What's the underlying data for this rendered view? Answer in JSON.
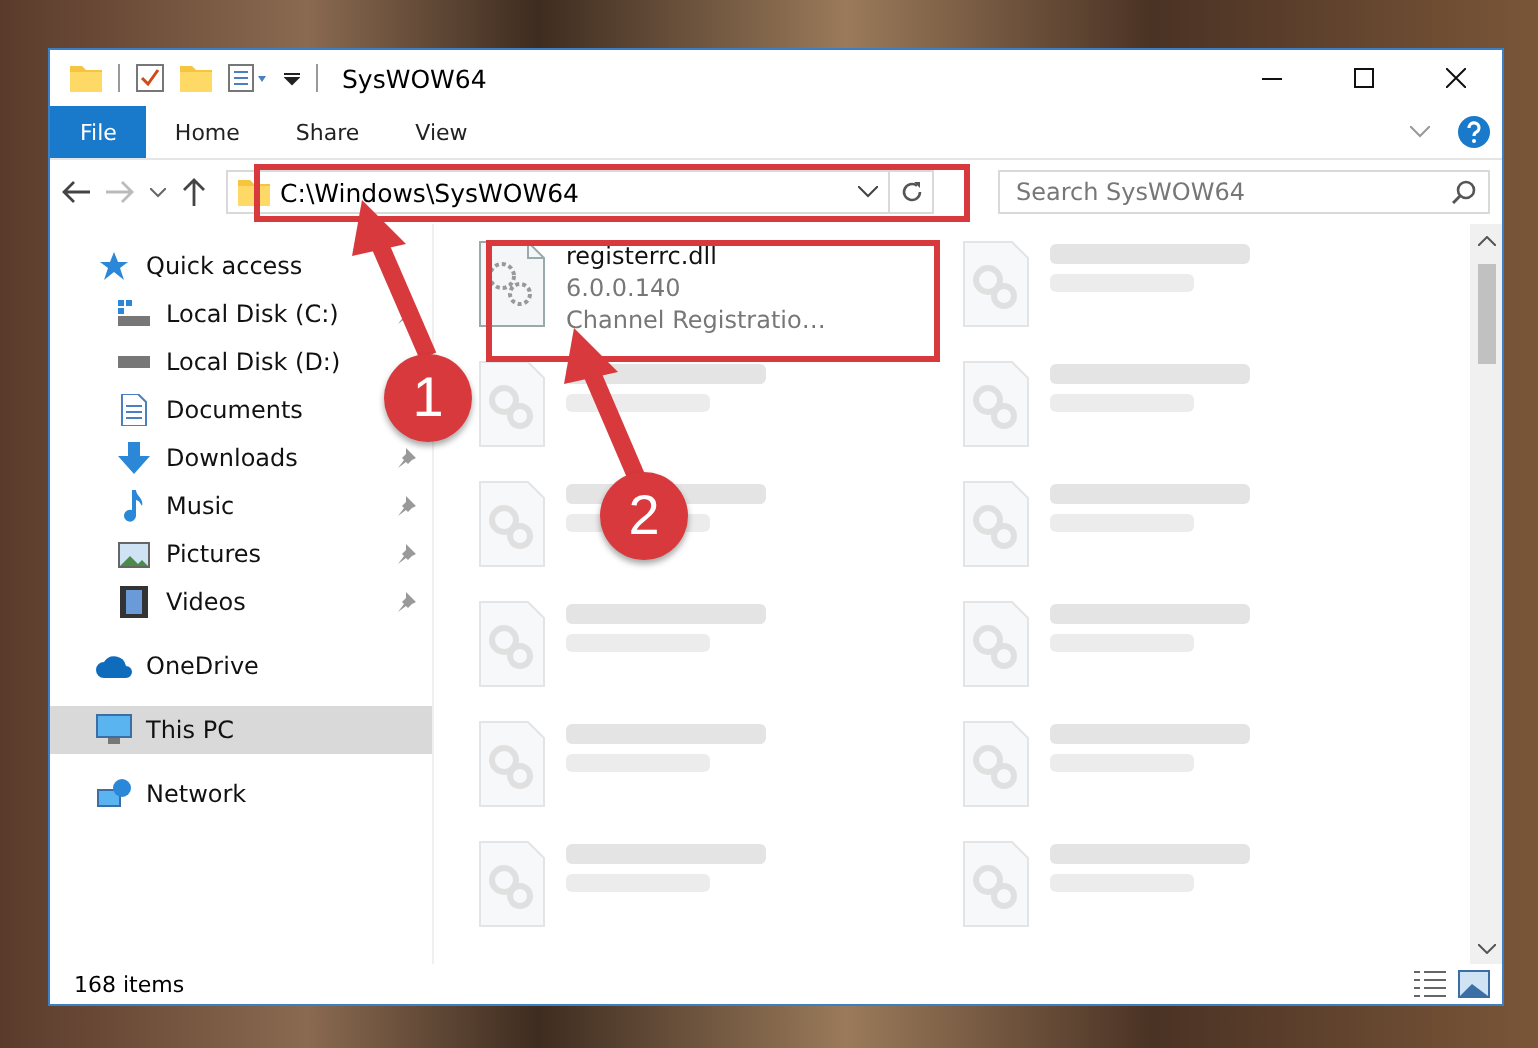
{
  "window": {
    "title": "SysWOW64"
  },
  "ribbon": {
    "tabs": [
      {
        "label": "File",
        "selected": true
      },
      {
        "label": "Home",
        "selected": false
      },
      {
        "label": "Share",
        "selected": false
      },
      {
        "label": "View",
        "selected": false
      }
    ]
  },
  "address_bar": {
    "path": "C:\\Windows\\SysWOW64"
  },
  "search": {
    "placeholder": "Search SysWOW64"
  },
  "sidebar": {
    "items": [
      {
        "label": "Quick access",
        "selected": false,
        "children": [
          {
            "label": "Local Disk (C:)",
            "pinned": true,
            "selected": false
          },
          {
            "label": "Local Disk (D:)",
            "pinned": false,
            "selected": false
          },
          {
            "label": "Documents",
            "pinned": false,
            "selected": false
          },
          {
            "label": "Downloads",
            "pinned": true,
            "selected": false
          },
          {
            "label": "Music",
            "pinned": true,
            "selected": false
          },
          {
            "label": "Pictures",
            "pinned": true,
            "selected": false
          },
          {
            "label": "Videos",
            "pinned": true,
            "selected": false
          }
        ]
      },
      {
        "label": "OneDrive",
        "selected": false
      },
      {
        "label": "This PC",
        "selected": true
      },
      {
        "label": "Network",
        "selected": false
      }
    ]
  },
  "files": [
    {
      "name": "registerrc.dll",
      "lines": [
        "6.0.0.140",
        "Channel Registratio…"
      ]
    }
  ],
  "status_bar": {
    "item_count": "168 items"
  },
  "annotations": [
    {
      "label": "1"
    },
    {
      "label": "2"
    }
  ]
}
